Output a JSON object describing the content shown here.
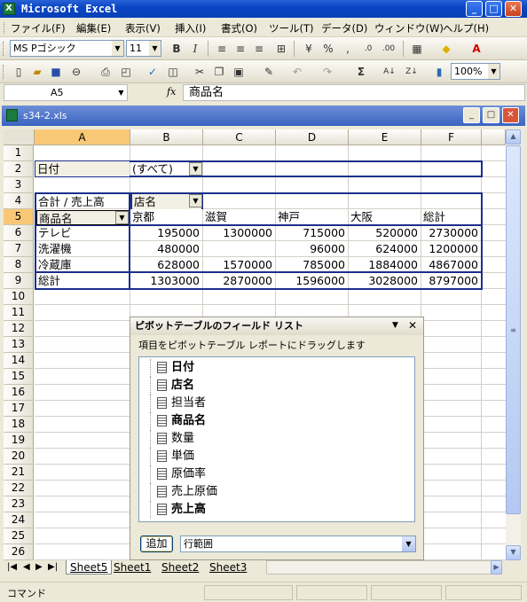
{
  "app": {
    "title": "Microsoft Excel",
    "icon": "excel-icon"
  },
  "menu": [
    "ファイル(F)",
    "編集(E)",
    "表示(V)",
    "挿入(I)",
    "書式(O)",
    "ツール(T)",
    "データ(D)",
    "ウィンドウ(W)",
    "ヘルプ(H)"
  ],
  "format_toolbar": {
    "font": "MS Pゴシック",
    "size": "11"
  },
  "standard_toolbar": {
    "zoom": "100%"
  },
  "formula": {
    "cell_ref": "A5",
    "fx": "fx",
    "content": "商品名"
  },
  "workbook": {
    "title": "s34-2.xls"
  },
  "columns": [
    "A",
    "B",
    "C",
    "D",
    "E",
    "F"
  ],
  "rows": [
    "1",
    "2",
    "3",
    "4",
    "5",
    "6",
    "7",
    "8",
    "9",
    "10",
    "11",
    "12",
    "13",
    "14",
    "15",
    "16",
    "17",
    "18",
    "19",
    "20",
    "21",
    "22",
    "23",
    "24",
    "25",
    "26"
  ],
  "pivot_table": {
    "page_label": "日付",
    "page_value": "(すべて)",
    "data_label": "合計 / 売上高",
    "col_field": "店名",
    "row_field": "商品名",
    "col_headers": [
      "京都",
      "滋賀",
      "神戸",
      "大阪",
      "総計"
    ],
    "rows": [
      {
        "label": "テレビ",
        "values": [
          "195000",
          "1300000",
          "715000",
          "520000",
          "2730000"
        ]
      },
      {
        "label": "洗濯機",
        "values": [
          "480000",
          "",
          "96000",
          "624000",
          "1200000"
        ]
      },
      {
        "label": "冷蔵庫",
        "values": [
          "628000",
          "1570000",
          "785000",
          "1884000",
          "4867000"
        ]
      },
      {
        "label": "総計",
        "values": [
          "1303000",
          "2870000",
          "1596000",
          "3028000",
          "8797000"
        ]
      }
    ]
  },
  "field_list": {
    "title": "ピボットテーブルのフィールド リスト",
    "subtitle": "項目をピボットテーブル レポートにドラッグします",
    "fields": [
      {
        "name": "日付",
        "bold": true
      },
      {
        "name": "店名",
        "bold": true
      },
      {
        "name": "担当者",
        "bold": false
      },
      {
        "name": "商品名",
        "bold": true
      },
      {
        "name": "数量",
        "bold": false
      },
      {
        "name": "単価",
        "bold": false
      },
      {
        "name": "原価率",
        "bold": false
      },
      {
        "name": "売上原価",
        "bold": false
      },
      {
        "name": "売上高",
        "bold": true
      }
    ],
    "add_button": "追加",
    "area": "行範囲"
  },
  "sheet_tabs": [
    "Sheet5",
    "Sheet1",
    "Sheet2",
    "Sheet3"
  ],
  "status": "コマンド"
}
